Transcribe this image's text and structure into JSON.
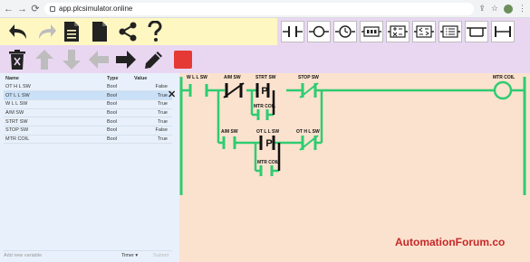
{
  "browser": {
    "url": "app.plcsimulator.online"
  },
  "variables": {
    "headers": {
      "name": "Name",
      "type": "Type",
      "value": "Value"
    },
    "rows": [
      {
        "name": "OT H L SW",
        "type": "Bool",
        "value": "False"
      },
      {
        "name": "OT L L SW",
        "type": "Bool",
        "value": "True"
      },
      {
        "name": "W L L SW",
        "type": "Bool",
        "value": "True"
      },
      {
        "name": "A/M SW",
        "type": "Bool",
        "value": "True"
      },
      {
        "name": "STRT SW",
        "type": "Bool",
        "value": "True"
      },
      {
        "name": "STOP SW",
        "type": "Bool",
        "value": "False"
      },
      {
        "name": "MTR COIL",
        "type": "Bool",
        "value": "True"
      }
    ],
    "delete_symbol": "✕",
    "add_placeholder": "Add new variable",
    "add_type": "Timer",
    "add_submit": "Submit"
  },
  "ladder": {
    "labels": {
      "wll": "W L L SW",
      "am1": "A/M SW",
      "strt": "STRT SW",
      "stop": "STOP SW",
      "coil": "MTR COIL",
      "seal1": "MTR COIL",
      "am2": "A/M SW",
      "otll": "OT L L SW",
      "othl": "OT H L SW",
      "seal2": "MTR COIL"
    },
    "energized_color": "#2ecc71",
    "coil_label_pos": "right"
  },
  "watermark": "AutomationForum.co",
  "colors": {
    "tb1_left": "#fff7c2",
    "tb_right": "#e9d7f2",
    "stop_button": "#e53935",
    "vars_bg": "#e8f1fb",
    "ladder_bg": "#fbe2ce"
  }
}
